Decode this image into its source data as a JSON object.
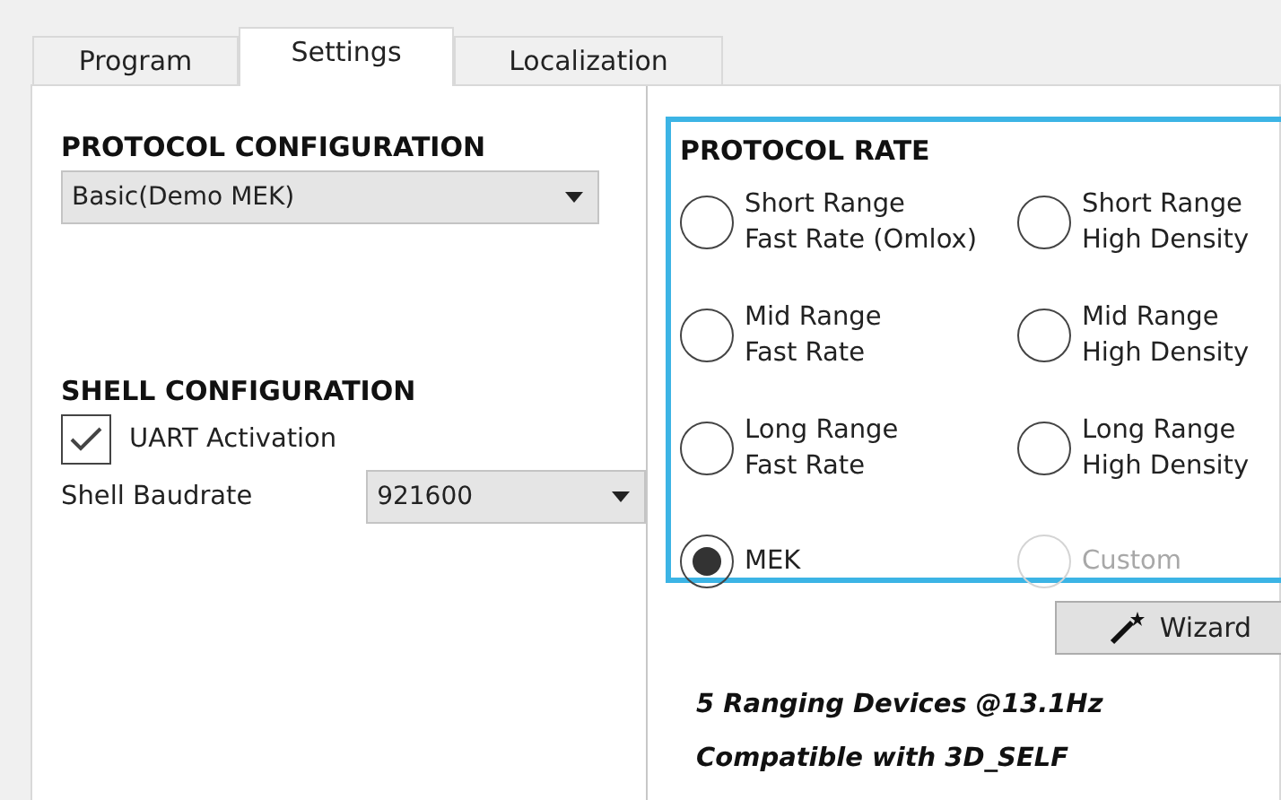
{
  "tabs": [
    {
      "label": "Program",
      "selected": false
    },
    {
      "label": "Settings",
      "selected": true
    },
    {
      "label": "Localization",
      "selected": false
    }
  ],
  "protocol_configuration": {
    "title": "PROTOCOL CONFIGURATION",
    "value": "Basic(Demo MEK)"
  },
  "shell_configuration": {
    "title": "SHELL CONFIGURATION",
    "uart_activation": {
      "label": "UART Activation",
      "checked": true
    },
    "baudrate": {
      "label": "Shell Baudrate",
      "value": "921600"
    }
  },
  "protocol_rate": {
    "title": "PROTOCOL RATE",
    "options": [
      {
        "label": [
          "Short Range",
          "Fast Rate (Omlox)"
        ],
        "selected": false,
        "disabled": false
      },
      {
        "label": [
          "Short Range",
          "High Density"
        ],
        "selected": false,
        "disabled": false
      },
      {
        "label": [
          "Mid Range",
          "Fast Rate"
        ],
        "selected": false,
        "disabled": false
      },
      {
        "label": [
          "Mid Range",
          "High Density"
        ],
        "selected": false,
        "disabled": false
      },
      {
        "label": [
          "Long Range",
          "Fast Rate"
        ],
        "selected": false,
        "disabled": false
      },
      {
        "label": [
          "Long Range",
          "High Density"
        ],
        "selected": false,
        "disabled": false
      },
      {
        "label": [
          "MEK"
        ],
        "selected": true,
        "disabled": false
      },
      {
        "label": [
          "Custom"
        ],
        "selected": false,
        "disabled": true
      }
    ]
  },
  "wizard_button": "Wizard",
  "info_lines": [
    "5 Ranging Devices @13.1Hz",
    "Compatible with 3D_SELF"
  ]
}
